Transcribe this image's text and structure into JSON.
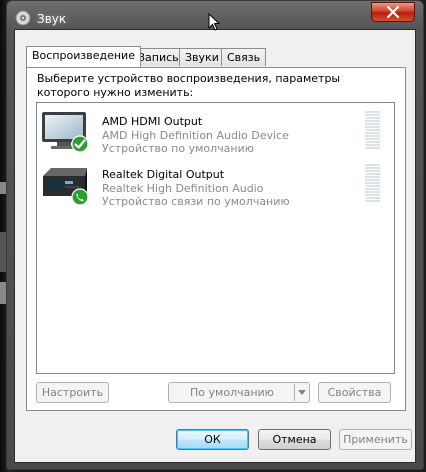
{
  "window": {
    "title": "Звук"
  },
  "tabs": [
    "Воспроизведение",
    "Запись",
    "Звуки",
    "Связь"
  ],
  "instruction": "Выберите устройство воспроизведения, параметры которого нужно изменить:",
  "devices": [
    {
      "name": "AMD HDMI Output",
      "driver": "AMD High Definition Audio Device",
      "status": "Устройство по умолчанию",
      "icon": "monitor-icon",
      "badge": "checkmark-badge-icon"
    },
    {
      "name": "Realtek Digital Output",
      "driver": "Realtek High Definition Audio",
      "status": "Устройство связи по умолчанию",
      "icon": "digital-output-device-icon",
      "badge": "phone-badge-icon"
    }
  ],
  "buttons": {
    "configure": "Настроить",
    "set_default": "По умолчанию",
    "properties": "Свойства",
    "ok": "ОК",
    "cancel": "Отмена",
    "apply": "Применить"
  },
  "colors": {
    "accent_green": "#2e9e2e",
    "close_red": "#c8321c",
    "disabled_text": "#838383"
  }
}
